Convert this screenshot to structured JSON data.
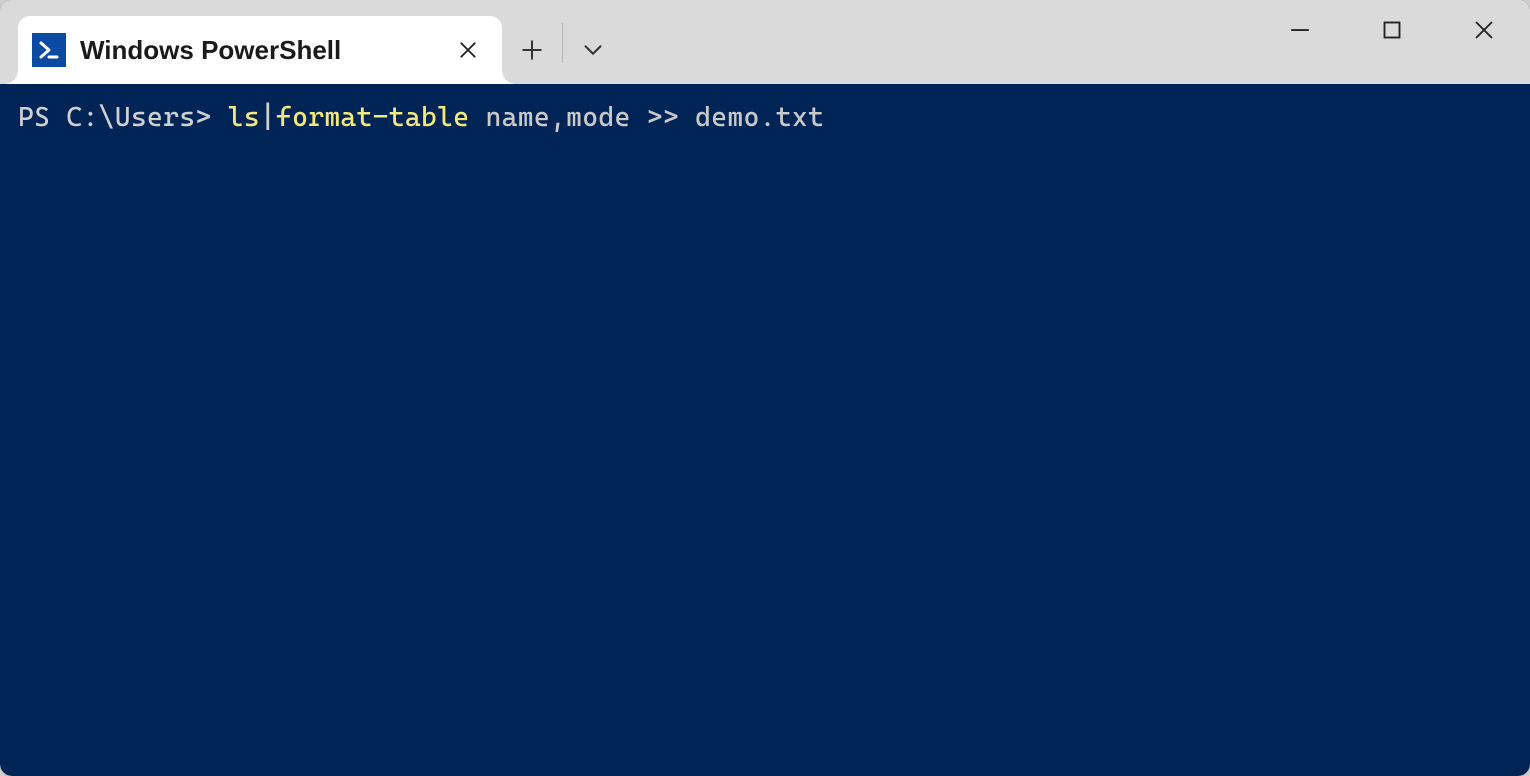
{
  "tab": {
    "title": "Windows PowerShell"
  },
  "terminal": {
    "prompt": "PS C:\\Users> ",
    "cmd1": "ls",
    "pipe": "|",
    "cmd2": "format-table",
    "space1": " ",
    "arg1": "name",
    "comma": ",",
    "arg2": "mode",
    "space2": " ",
    "redir": ">>",
    "space3": " ",
    "file": "demo.txt"
  }
}
